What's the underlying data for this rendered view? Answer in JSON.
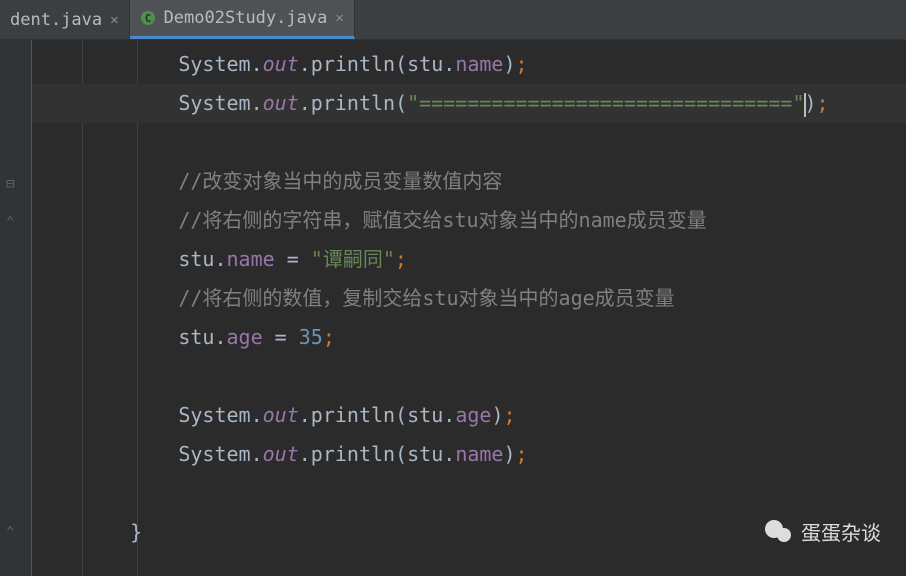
{
  "tabs": [
    {
      "label": "dent.java",
      "active": false
    },
    {
      "label": "Demo02Study.java",
      "active": true
    }
  ],
  "code": {
    "line1": {
      "System": "System",
      "out": "out",
      "println": "println",
      "stu": "stu",
      "name": "name"
    },
    "line2": {
      "System": "System",
      "out": "out",
      "println": "println",
      "str": "\"===============================\""
    },
    "line4": {
      "comment": "//改变对象当中的成员变量数值内容"
    },
    "line5": {
      "comment": "//将右侧的字符串，赋值交给stu对象当中的name成员变量"
    },
    "line6": {
      "stu": "stu",
      "name": "name",
      "eq": " = ",
      "str": "\"谭嗣同\""
    },
    "line7": {
      "comment": "//将右侧的数值，复制交给stu对象当中的age成员变量"
    },
    "line8": {
      "stu": "stu",
      "age": "age",
      "eq": " = ",
      "num": "35"
    },
    "line10": {
      "System": "System",
      "out": "out",
      "println": "println",
      "stu": "stu",
      "age": "age"
    },
    "line11": {
      "System": "System",
      "out": "out",
      "println": "println",
      "stu": "stu",
      "name": "name"
    },
    "line13": {
      "brace": "}"
    }
  },
  "watermark": {
    "text": "蛋蛋杂谈"
  }
}
